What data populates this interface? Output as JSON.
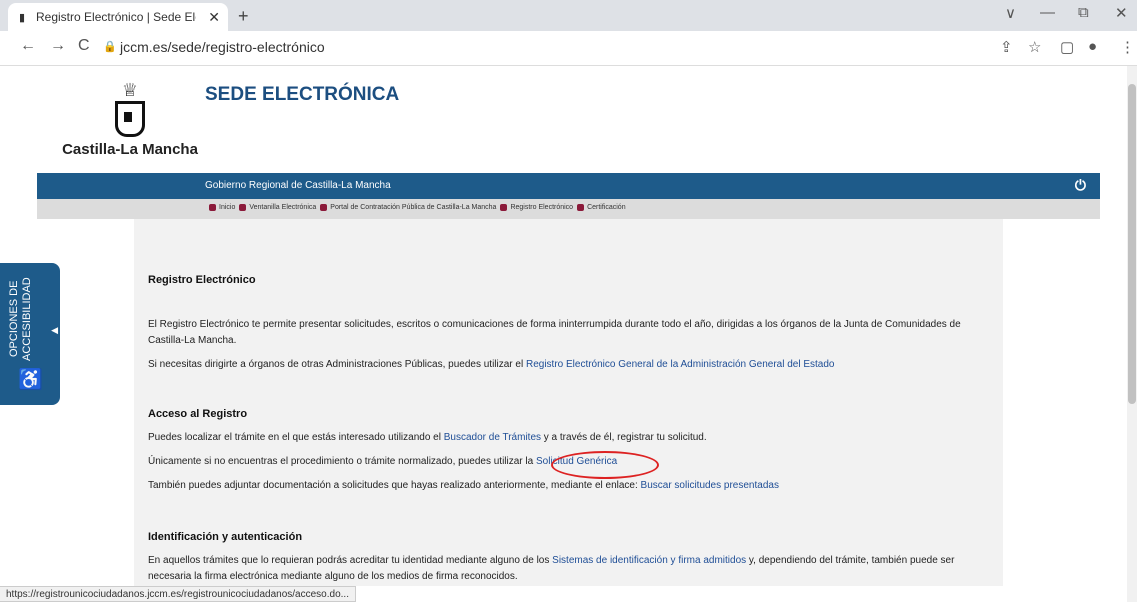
{
  "browser": {
    "tab_title": "Registro Electrónico | Sede Electró",
    "tab_close": "✕",
    "new_tab": "+",
    "minimize": "∨",
    "minimize2": "—",
    "restore": "⧉",
    "close": "✕",
    "back": "←",
    "forward": "→",
    "reload": "C",
    "lock": "🔒",
    "url": "jccm.es/sede/registro-electrónico",
    "share": "⇪",
    "star": "☆",
    "sidepanel": "▢",
    "profile": "●",
    "menu": "⋮"
  },
  "header": {
    "logo_text": "Castilla-La Mancha",
    "crown": "♕",
    "title": "SEDE ELECTRÓNICA"
  },
  "bluebar": {
    "text": "Gobierno Regional de Castilla-La Mancha",
    "power": "⏻"
  },
  "breadcrumbs": [
    "Inicio",
    "Ventanilla Electrónica",
    "Portal de Contratación Pública de Castilla-La Mancha",
    "Registro Electrónico",
    "Certificación"
  ],
  "accessibility": {
    "label": "OPCIONES DE ACCESIBILIDAD",
    "arrow": "◀",
    "icon": "♿"
  },
  "content": {
    "h1": "Registro Electrónico",
    "p1": "El Registro Electrónico te permite presentar solicitudes, escritos o comunicaciones de forma ininterrumpida durante todo el año, dirigidas a los órganos de la Junta de Comunidades de Castilla-La Mancha.",
    "p2_pre": "Si necesitas dirigirte a órganos de otras Administraciones Públicas, puedes utilizar el ",
    "p2_link": "Registro Electrónico General de la Administración General del Estado",
    "h2": "Acceso al Registro",
    "p3_pre": "Puedes localizar el trámite en el que estás interesado utilizando el ",
    "p3_link": "Buscador de Trámites",
    "p3_post": " y a través de él, registrar tu solicitud.",
    "p4_pre": "Únicamente si no encuentras el procedimiento o trámite normalizado, puedes utilizar la ",
    "p4_link": "Solicitud Genérica",
    "p5_pre": "También puedes adjuntar documentación a solicitudes que hayas realizado anteriormente, mediante el enlace: ",
    "p5_link": "Buscar solicitudes presentadas",
    "h3": "Identificación y autenticación",
    "p6_pre": "En aquellos trámites que lo requieran podrás acreditar tu identidad mediante alguno de los ",
    "p6_link": "Sistemas de identificación y firma admitidos",
    "p6_post": "  y, dependiendo del trámite, también puede ser necesaria la firma electrónica mediante alguno de los medios de firma reconocidos."
  },
  "status_url": "https://registrounicociudadanos.jccm.es/registrounicociudadanos/acceso.do..."
}
